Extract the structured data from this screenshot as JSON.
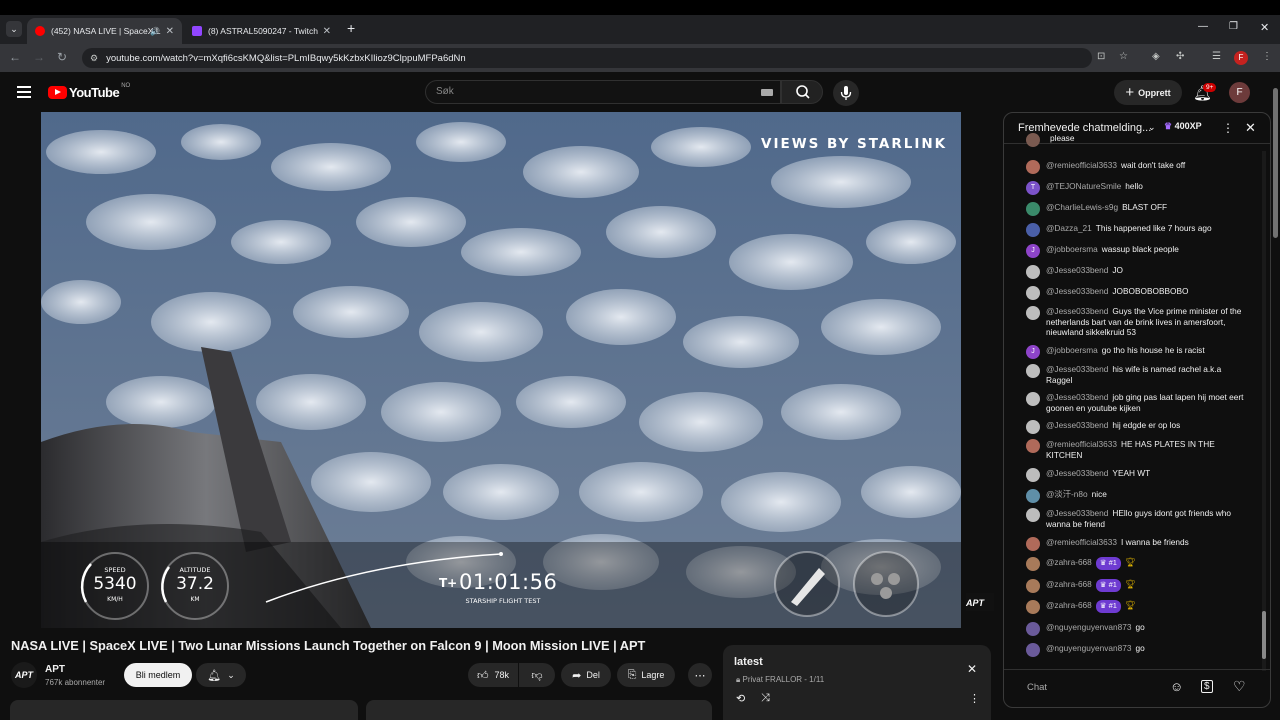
{
  "browser": {
    "tabs": [
      {
        "label": "(452) NASA LIVE | SpaceX L",
        "active": true,
        "favicon_color": "#ff0000"
      },
      {
        "label": "(8) ASTRAL5090247 - Twitch",
        "active": false,
        "favicon_color": "#9146ff"
      }
    ],
    "url": "youtube.com/watch?v=mXqfi6csKMQ&list=PLmIBqwy5kKzbxKIlioz9ClppuMFPa6dNn",
    "profile_initial": "F"
  },
  "youtube": {
    "logo_text": "YouTube",
    "logo_region": "NO",
    "search_placeholder": "Søk",
    "create_label": "Opprett",
    "notification_count": "9+",
    "avatar_initial": "F"
  },
  "video": {
    "overlay_caption": "VIEWS BY STARLINK",
    "speed_label": "SPEED",
    "speed_value": "5340",
    "speed_unit": "KM/H",
    "altitude_label": "ALTITUDE",
    "altitude_value": "37.2",
    "altitude_unit": "KM",
    "timer_prefix": "T+",
    "timer": "01:01:56",
    "timer_caption": "STARSHIP FLIGHT TEST",
    "watermark": "APT",
    "title": "NASA LIVE | SpaceX LIVE | Two Lunar Missions Launch Together on Falcon 9 | Moon Mission LIVE | APT"
  },
  "channel": {
    "name": "APT",
    "subscribers": "767k abonnenter",
    "join_label": "Bli medlem",
    "logo_text": "APT",
    "like_count": "78k",
    "share_label": "Del",
    "save_label": "Lagre"
  },
  "playlist": {
    "title": "latest",
    "info": "Privat FRALLOR - 1/11"
  },
  "chat": {
    "header_title": "Fremhevede chatmelding...",
    "xp_badge": "400XP",
    "input_placeholder": "Chat",
    "messages": [
      {
        "author": "",
        "text": "please",
        "avatar_color": "#7a5a50"
      },
      {
        "author": "@remieofficial3633",
        "text": "wait don't take off",
        "avatar_color": "#b06a5a"
      },
      {
        "author": "@TEJONatureSmile",
        "text": "hello",
        "avatar_color": "#7b52c9",
        "initial": "T"
      },
      {
        "author": "@CharlieLewis-s9g",
        "text": "BLAST OFF",
        "avatar_color": "#3a8a6a"
      },
      {
        "author": "@Dazza_21",
        "text": "This happened like 7 hours ago",
        "avatar_color": "#4a5fa8"
      },
      {
        "author": "@jobboersma",
        "text": "wassup black people",
        "avatar_color": "#8e44c9",
        "initial": "J"
      },
      {
        "author": "@Jesse033bend",
        "text": "JO",
        "avatar_color": "#bdbdbd"
      },
      {
        "author": "@Jesse033bend",
        "text": "JOBOBOBOBBOBO",
        "avatar_color": "#bdbdbd"
      },
      {
        "author": "@Jesse033bend",
        "text": "Guys the Vice prime minister of the netherlands bart van de brink lives in amersfoort, nieuwland sikkelkruid 53",
        "avatar_color": "#bdbdbd"
      },
      {
        "author": "@jobboersma",
        "text": "go tho his house he is racist",
        "avatar_color": "#8e44c9",
        "initial": "J"
      },
      {
        "author": "@Jesse033bend",
        "text": "his wife is named rachel a.k.a Raggel",
        "avatar_color": "#bdbdbd"
      },
      {
        "author": "@Jesse033bend",
        "text": "job ging pas laat lapen hij moet eert goonen en youtube kijken",
        "avatar_color": "#bdbdbd"
      },
      {
        "author": "@Jesse033bend",
        "text": "hij edgde er op los",
        "avatar_color": "#bdbdbd"
      },
      {
        "author": "@remieofficial3633",
        "text": "HE HAS PLATES IN THE KITCHEN",
        "avatar_color": "#b06a5a"
      },
      {
        "author": "@Jesse033bend",
        "text": "YEAH WT",
        "avatar_color": "#bdbdbd"
      },
      {
        "author": "@淡汗-n8o",
        "text": "nice",
        "avatar_color": "#5f8fa8"
      },
      {
        "author": "@Jesse033bend",
        "text": "HEllo guys idont got friends who wanna be friend",
        "avatar_color": "#bdbdbd"
      },
      {
        "author": "@remieofficial3633",
        "text": "I wanna be friends",
        "avatar_color": "#b06a5a"
      },
      {
        "author": "@zahra-668",
        "text": "",
        "badge": "#1",
        "avatar_color": "#a87a5a"
      },
      {
        "author": "@zahra-668",
        "text": "",
        "badge": "#1",
        "avatar_color": "#a87a5a"
      },
      {
        "author": "@zahra-668",
        "text": "",
        "badge": "#1",
        "avatar_color": "#a87a5a"
      },
      {
        "author": "@nguyenguyenvan873",
        "text": "go",
        "avatar_color": "#6a5a9a"
      },
      {
        "author": "@nguyenguyenvan873",
        "text": "go",
        "avatar_color": "#6a5a9a"
      }
    ]
  }
}
